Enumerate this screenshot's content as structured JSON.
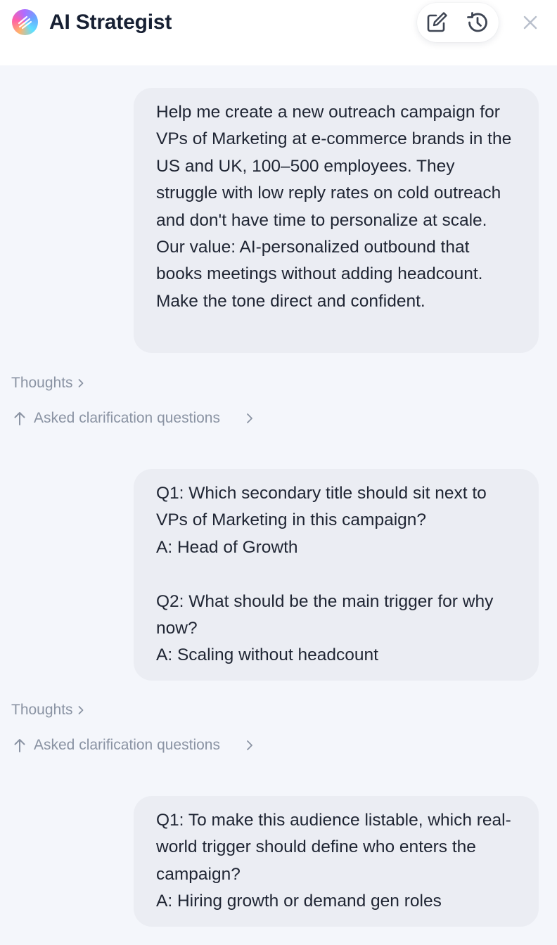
{
  "header": {
    "title": "AI Strategist",
    "logo_icon": "brand-gradient-icon",
    "actions": {
      "new_chat_icon": "new-chat-icon",
      "history_icon": "history-icon",
      "close_icon": "close-icon"
    }
  },
  "colors": {
    "background": "#f4f6fb",
    "header_background": "#ffffff",
    "bubble_background": "#ebedf3",
    "muted_text": "#8a93a3",
    "body_text": "#1f2533"
  },
  "conversation": [
    {
      "type": "user_message",
      "text": "Help me create a new outreach campaign for VPs of Marketing at e-commerce brands in the US and UK, 100–500 employees. They struggle with low reply rates on cold outreach and don't have time to personalize at scale. Our value: AI-personalized outbound that books meetings without adding headcount. Make the tone direct and confident."
    },
    {
      "type": "thoughts",
      "label": "Thoughts"
    },
    {
      "type": "action",
      "label": "Asked clarification questions"
    },
    {
      "type": "user_message",
      "text": "Q1: Which secondary title should sit next to VPs of Marketing in this campaign?\nA: Head of Growth\n\nQ2: What should be the main trigger for why now?\nA: Scaling without headcount"
    },
    {
      "type": "thoughts",
      "label": "Thoughts"
    },
    {
      "type": "action",
      "label": "Asked clarification questions"
    },
    {
      "type": "user_message",
      "text": "Q1: To make this audience listable, which real-world trigger should define who enters the campaign?\nA: Hiring growth or demand gen roles"
    }
  ]
}
